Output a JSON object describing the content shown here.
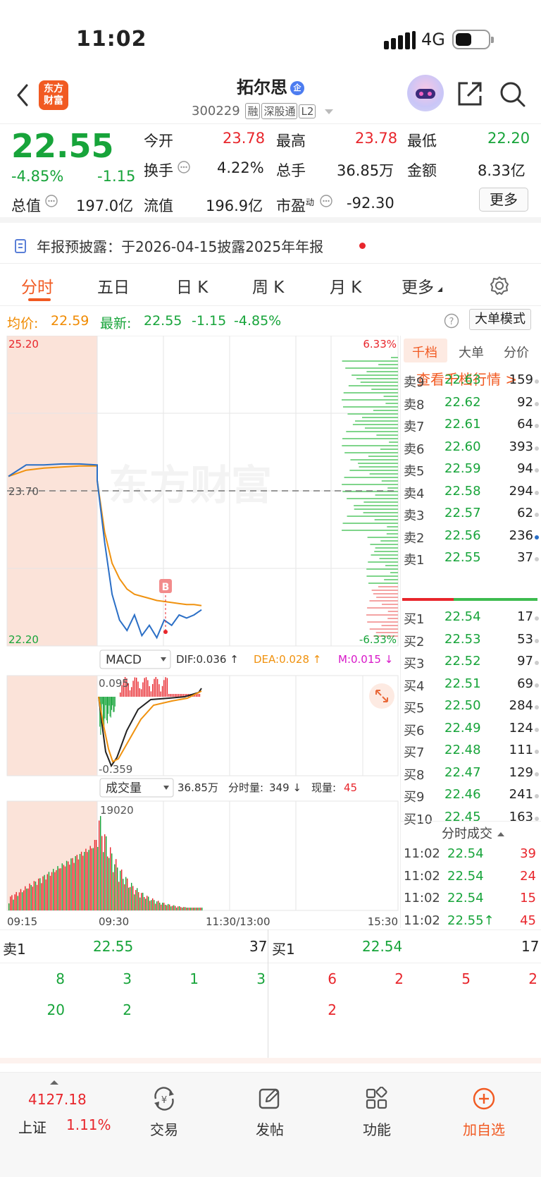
{
  "status_bar": {
    "time": "11:02",
    "network": "4G"
  },
  "header": {
    "stock_name": "拓尔思",
    "qiye_badge": "企",
    "code": "300229",
    "tags": [
      "融",
      "深股通",
      "L2"
    ],
    "logo_text": "东方财富"
  },
  "quote": {
    "price": "22.55",
    "change_pct": "-4.85%",
    "change": "-1.15",
    "fields": [
      {
        "label": "今开",
        "value": "23.78",
        "color": "red"
      },
      {
        "label": "最高",
        "value": "23.78",
        "color": "red"
      },
      {
        "label": "最低",
        "value": "22.20",
        "color": "green"
      },
      {
        "label": "换手",
        "value": "4.22%",
        "color": "dark"
      },
      {
        "label": "总手",
        "value": "36.85万",
        "color": "dark"
      },
      {
        "label": "金额",
        "value": "8.33亿",
        "color": "dark"
      },
      {
        "label": "总值",
        "value": "197.0亿",
        "color": "dark"
      },
      {
        "label": "流值",
        "value": "196.9亿",
        "color": "dark"
      },
      {
        "label": "市盈",
        "sup": "动",
        "value": "-92.30",
        "color": "dark"
      }
    ],
    "more_label": "更多"
  },
  "notice": {
    "text": "年报预披露：于2026-04-15披露2025年年报"
  },
  "tabs": [
    "分时",
    "五日",
    "日 K",
    "周 K",
    "月 K",
    "更多"
  ],
  "info_line": {
    "avg_label": "均价:",
    "avg_value": "22.59",
    "latest_label": "最新:",
    "latest_value": "22.55",
    "change": "-1.15",
    "change_pct": "-4.85%",
    "mode_button": "大单模式"
  },
  "chart_data": {
    "type": "line",
    "title": "",
    "price_axis": {
      "max": "25.20",
      "min": "22.20",
      "prev_close": "23.70",
      "max_pct": "6.33%",
      "min_pct": "-6.33%",
      "ylim": [
        22.2,
        25.2
      ]
    },
    "series": [
      {
        "name": "price",
        "color": "#2b6fc6",
        "values": [
          23.84,
          23.95,
          23.95,
          23.96,
          23.96,
          23.95,
          23.8,
          23.2,
          22.7,
          22.45,
          22.35,
          22.5,
          22.3,
          22.4,
          22.28,
          22.45,
          22.4,
          22.5,
          22.47,
          22.5,
          22.55
        ]
      },
      {
        "name": "avg",
        "color": "#f0920f",
        "values": [
          23.84,
          23.9,
          23.92,
          23.93,
          23.94,
          23.94,
          23.8,
          23.3,
          23.0,
          22.85,
          22.75,
          22.7,
          22.68,
          22.66,
          22.64,
          22.63,
          22.62,
          22.61,
          22.6,
          22.6,
          22.59
        ]
      }
    ],
    "time_labels": [
      "09:15",
      "09:30",
      "11:30/13:00",
      "15:30"
    ],
    "marker": "B",
    "macd": {
      "label": "MACD",
      "dif": "DIF:0.036 ↑",
      "dea": "DEA:0.028 ↑",
      "m": "M:0.015 ↓",
      "top": "0.095",
      "bottom": "-0.359"
    },
    "volume": {
      "label": "成交量",
      "total": "36.85万",
      "fenshi_label": "分时量:",
      "fenshi": "349 ↓",
      "xian_label": "现量:",
      "xian": "45",
      "max": "19020"
    }
  },
  "watermark": "东方财富",
  "orderbook": {
    "tabs": [
      "千档",
      "大单",
      "分价"
    ],
    "link": "查看千档行情 >",
    "asks": [
      {
        "label": "卖9",
        "price": "22.63",
        "vol": "159"
      },
      {
        "label": "卖8",
        "price": "22.62",
        "vol": "92"
      },
      {
        "label": "卖7",
        "price": "22.61",
        "vol": "64"
      },
      {
        "label": "卖6",
        "price": "22.60",
        "vol": "393"
      },
      {
        "label": "卖5",
        "price": "22.59",
        "vol": "94"
      },
      {
        "label": "卖4",
        "price": "22.58",
        "vol": "294"
      },
      {
        "label": "卖3",
        "price": "22.57",
        "vol": "62"
      },
      {
        "label": "卖2",
        "price": "22.56",
        "vol": "236"
      },
      {
        "label": "卖1",
        "price": "22.55",
        "vol": "37"
      }
    ],
    "bids": [
      {
        "label": "买1",
        "price": "22.54",
        "vol": "17"
      },
      {
        "label": "买2",
        "price": "22.53",
        "vol": "53"
      },
      {
        "label": "买3",
        "price": "22.52",
        "vol": "97"
      },
      {
        "label": "买4",
        "price": "22.51",
        "vol": "69"
      },
      {
        "label": "买5",
        "price": "22.50",
        "vol": "284"
      },
      {
        "label": "买6",
        "price": "22.49",
        "vol": "124"
      },
      {
        "label": "买7",
        "price": "22.48",
        "vol": "111"
      },
      {
        "label": "买8",
        "price": "22.47",
        "vol": "129"
      },
      {
        "label": "买9",
        "price": "22.46",
        "vol": "241"
      },
      {
        "label": "买10",
        "price": "22.45",
        "vol": "163"
      }
    ],
    "ticks_title": "分时成交",
    "ticks": [
      {
        "time": "11:02",
        "price": "22.54",
        "vol": "39"
      },
      {
        "time": "11:02",
        "price": "22.54",
        "vol": "24"
      },
      {
        "time": "11:02",
        "price": "22.54",
        "vol": "15"
      },
      {
        "time": "11:02",
        "price": "22.55↑",
        "vol": "45"
      }
    ]
  },
  "queue": {
    "sell_label": "卖1",
    "sell_price": "22.55",
    "sell_vol": "37",
    "buy_label": "买1",
    "buy_price": "22.54",
    "buy_vol": "17",
    "sell_rows": [
      [
        "8",
        "3",
        "1",
        "3"
      ],
      [
        "20",
        "2",
        "",
        ""
      ]
    ],
    "buy_rows": [
      [
        "6",
        "2",
        "5",
        "2"
      ],
      [
        "2",
        "",
        "",
        ""
      ]
    ]
  },
  "tabbar": {
    "index_value": "4127.18",
    "index_name": "上证",
    "index_pct": "1.11%",
    "items": [
      "交易",
      "发帖",
      "功能",
      "加自选"
    ]
  }
}
